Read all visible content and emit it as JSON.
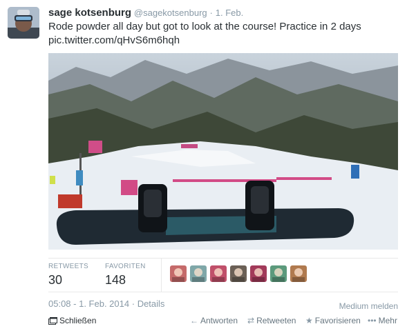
{
  "tweet": {
    "fullname": "sage kotsenburg",
    "username": "@sagekotsenburg",
    "separator": "·",
    "date": "1. Feb.",
    "text": "Rode powder all day but got to look at the course!  Practice in 2 days",
    "link": "pic.twitter.com/qHvS6m6hqh"
  },
  "stats": {
    "retweets_label": "RETWEETS",
    "retweets_value": "30",
    "favorites_label": "FAVORITEN",
    "favorites_value": "148"
  },
  "favoriters": [
    {
      "name": "favoriter-avatar-1",
      "color": "#c56a6a"
    },
    {
      "name": "favoriter-avatar-2",
      "color": "#7fa7a8"
    },
    {
      "name": "favoriter-avatar-3",
      "color": "#c0506a"
    },
    {
      "name": "favoriter-avatar-4",
      "color": "#6b6056"
    },
    {
      "name": "favoriter-avatar-5",
      "color": "#a23a5a"
    },
    {
      "name": "favoriter-avatar-6",
      "color": "#5c9a7c"
    },
    {
      "name": "favoriter-avatar-7",
      "color": "#b07a4f"
    }
  ],
  "meta": {
    "timestamp": "05:08 - 1. Feb. 2014",
    "details_sep": "·",
    "details_label": "Details",
    "report_label": "Medium melden"
  },
  "actions": {
    "close_label": "Schließen",
    "reply_label": "Antworten",
    "retweet_label": "Retweeten",
    "favorite_label": "Favorisieren",
    "more_label": "Mehr"
  },
  "icons": {
    "reply": "←",
    "retweet": "⇄",
    "favorite": "★",
    "more": "•••"
  }
}
